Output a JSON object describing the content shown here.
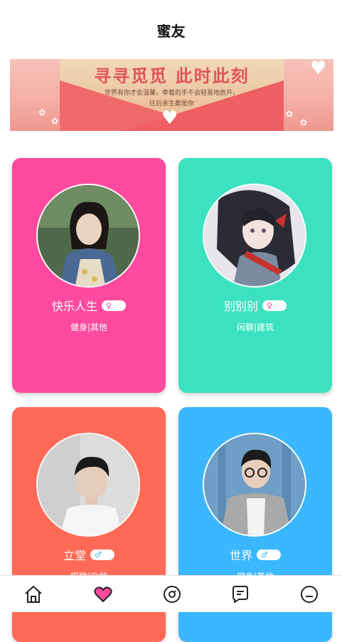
{
  "header": {
    "title": "蜜友"
  },
  "banner": {
    "headline": "寻寻觅觅 此时此刻",
    "line1": "世界有你才会温馨，牵着的手不会轻易地放开，",
    "line2": "往后余生都是你"
  },
  "cards": [
    {
      "name": "快乐人生",
      "gender": "female",
      "gender_icon": "female-icon",
      "tags": "健身|其他",
      "color": "#fe4a9e"
    },
    {
      "name": "别别别",
      "gender": "female",
      "gender_icon": "female-icon",
      "tags": "闲聊|建筑",
      "color": "#3ce2c0"
    },
    {
      "name": "立堂",
      "gender": "male",
      "gender_icon": "male-icon",
      "tags": "唱歌|白领",
      "color": "#fe6a56"
    },
    {
      "name": "世界",
      "gender": "male",
      "gender_icon": "male-icon",
      "tags": "健身|其他",
      "color": "#3ab7ff"
    }
  ],
  "tabbar": {
    "items": [
      {
        "icon": "home-icon",
        "active": false
      },
      {
        "icon": "heart-icon",
        "active": true
      },
      {
        "icon": "compass-icon",
        "active": false
      },
      {
        "icon": "message-icon",
        "active": false
      },
      {
        "icon": "profile-icon",
        "active": false
      }
    ],
    "active_color": "#fe4a9e",
    "inactive_color": "#222222"
  }
}
